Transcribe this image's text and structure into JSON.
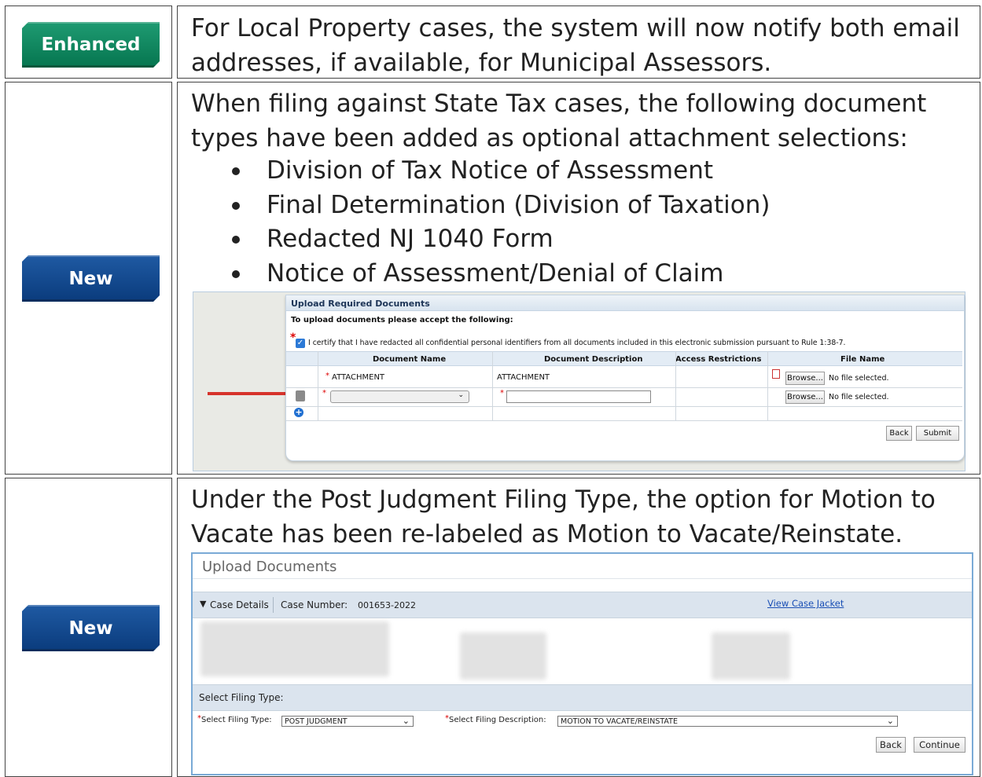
{
  "rows": [
    {
      "badge": "Enhanced",
      "badge_color": "#0b7f57",
      "text": "For Local Property cases, the system will now notify both email addresses, if available, for Municipal Assessors."
    },
    {
      "badge": "New",
      "badge_color": "#0d4487",
      "intro": "When filing against State Tax cases, the following document types have been added as optional attachment selections:",
      "bullets": [
        "Division of Tax Notice of Assessment",
        "Final Determination (Division of Taxation)",
        "Redacted NJ 1040 Form",
        "Notice of Assessment/Denial of Claim"
      ],
      "screenshot": {
        "panel_title": "Upload Required Documents",
        "instruction": "To upload documents please accept the following:",
        "certify": "I certify that I have redacted all confidential personal identifiers from all documents included in this electronic submission pursuant to Rule 1:38-7.",
        "columns": [
          "Document Name",
          "Document Description",
          "Access Restrictions",
          "File Name"
        ],
        "row1": {
          "name": "ATTACHMENT",
          "description": "ATTACHMENT"
        },
        "browse": "Browse...",
        "no_file": "No file selected.",
        "back": "Back",
        "submit": "Submit"
      }
    },
    {
      "badge": "New",
      "badge_color": "#0d4487",
      "text": "Under the Post Judgment Filing Type, the option for Motion to Vacate has been re-labeled as Motion to Vacate/Reinstate.",
      "screenshot": {
        "title": "Upload Documents",
        "case_details": "Case Details",
        "case_number_label": "Case Number:",
        "case_number": "001653-2022",
        "view_case_jacket": "View Case Jacket",
        "select_filing_type_header": "Select Filing Type:",
        "filing_type_label": "Select Filing Type:",
        "filing_type_value": "POST JUDGMENT",
        "filing_desc_label": "Select Filing Description:",
        "filing_desc_value": "MOTION TO VACATE/REINSTATE",
        "back": "Back",
        "continue": "Continue"
      }
    }
  ]
}
